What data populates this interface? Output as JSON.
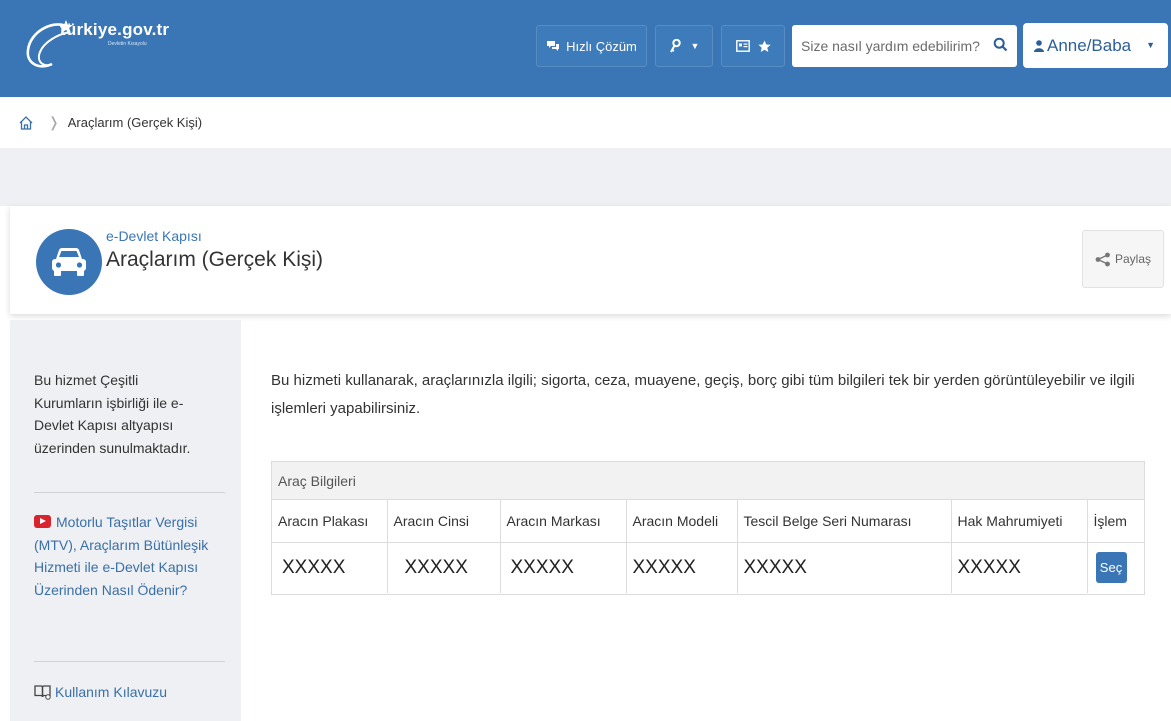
{
  "header": {
    "logo_text": "türkiye.gov.tr",
    "logo_tagline": "Devletin Kısayolu",
    "quick_solution_label": "Hızlı Çözüm",
    "search_placeholder": "Size nasıl yardım edebilirim?",
    "user_label": "Anne/Baba"
  },
  "breadcrumb": {
    "current": "Araçlarım (Gerçek Kişi)"
  },
  "page_header": {
    "subtitle": "e-Devlet Kapısı",
    "title": "Araçlarım (Gerçek Kişi)",
    "share_label": "Paylaş"
  },
  "sidebar": {
    "info_text": "Bu hizmet Çeşitli Kurumların işbirliği ile e-Devlet Kapısı altyapısı üzerinden sunulmaktadır.",
    "video_link": "Motorlu Taşıtlar Vergisi (MTV), Araçlarım Bütünleşik Hizmeti ile e-Devlet Kapısı Üzerinden Nasıl Ödenir?",
    "guide_link": "Kullanım Kılavuzu"
  },
  "main": {
    "intro": "Bu hizmeti kullanarak, araçlarınızla ilgili; sigorta, ceza, muayene, geçiş, borç gibi tüm bilgileri tek bir yerden görüntüleyebilir ve ilgili işlemleri yapabilirsiniz.",
    "panel_title": "Araç Bilgileri",
    "columns": [
      "Aracın Plakası",
      "Aracın Cinsi",
      "Aracın Markası",
      "Aracın Modeli",
      "Tescil Belge Seri Numarası",
      "Hak Mahrumiyeti",
      "İşlem"
    ],
    "rows": [
      [
        "XXXXX",
        "XXXXX",
        "XXXXX",
        "XXXXX",
        "XXXXX",
        "XXXXX"
      ]
    ],
    "select_button": "Seç"
  },
  "colors": {
    "brand_blue": "#3a76b6",
    "link_blue": "#3a6fa8",
    "youtube_red": "#d9232d"
  }
}
